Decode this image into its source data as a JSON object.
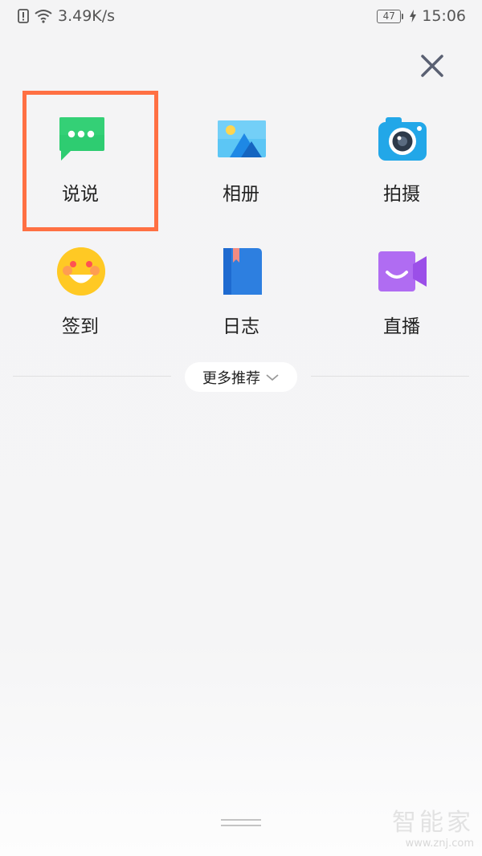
{
  "status_bar": {
    "network_speed": "3.49K/s",
    "battery_level": "47",
    "time": "15:06"
  },
  "actions": [
    {
      "label": "说说",
      "icon": "speech-bubble-icon",
      "color": "#2ecc71"
    },
    {
      "label": "相册",
      "icon": "photo-album-icon",
      "color": "#42b4f0"
    },
    {
      "label": "拍摄",
      "icon": "camera-icon",
      "color": "#22a7e8"
    },
    {
      "label": "签到",
      "icon": "smiley-face-icon",
      "color": "#ffc107"
    },
    {
      "label": "日志",
      "icon": "journal-book-icon",
      "color": "#2d7fe0"
    },
    {
      "label": "直播",
      "icon": "video-camera-icon",
      "color": "#b06cf2"
    }
  ],
  "more": {
    "label": "更多推荐"
  },
  "watermark": {
    "main": "智能家",
    "sub": "www.znj.com"
  },
  "colors": {
    "highlight": "#ff7043",
    "background": "#f5f5f6"
  }
}
